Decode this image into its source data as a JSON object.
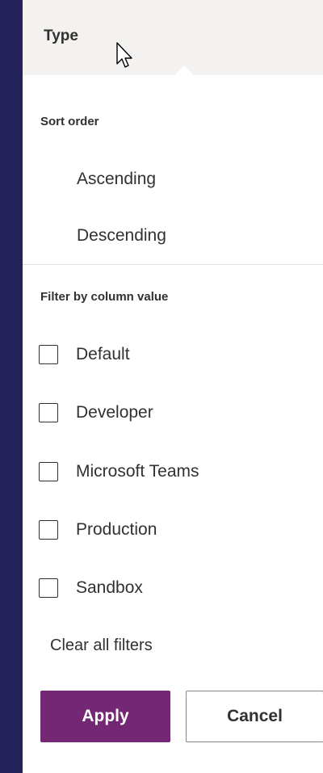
{
  "column_header": {
    "label": "Type"
  },
  "sort": {
    "title": "Sort order",
    "options": [
      "Ascending",
      "Descending"
    ]
  },
  "filter": {
    "title": "Filter by column value",
    "options": [
      {
        "label": "Default",
        "checked": false
      },
      {
        "label": "Developer",
        "checked": false
      },
      {
        "label": "Microsoft Teams",
        "checked": false
      },
      {
        "label": "Production",
        "checked": false
      },
      {
        "label": "Sandbox",
        "checked": false
      }
    ],
    "clear_label": "Clear all filters"
  },
  "actions": {
    "apply_label": "Apply",
    "cancel_label": "Cancel"
  },
  "colors": {
    "accent": "#742774",
    "page_background": "#23225a",
    "header_background": "#f3f2f1"
  }
}
